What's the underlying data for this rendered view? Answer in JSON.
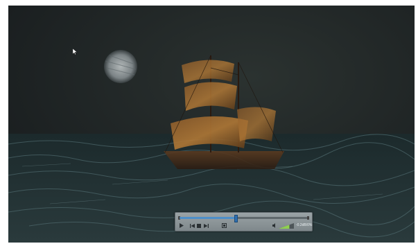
{
  "player": {
    "volume_label": "-0.2dB/0%",
    "volume_level": 0.7,
    "seek_position": 0.44,
    "accent_color": "#4d8fc9"
  },
  "icons": {
    "play": "play-icon",
    "previous": "skip-back-icon",
    "stop": "stop-icon",
    "next": "skip-forward-icon",
    "fullscreen": "fullscreen-icon",
    "speaker": "speaker-icon"
  }
}
